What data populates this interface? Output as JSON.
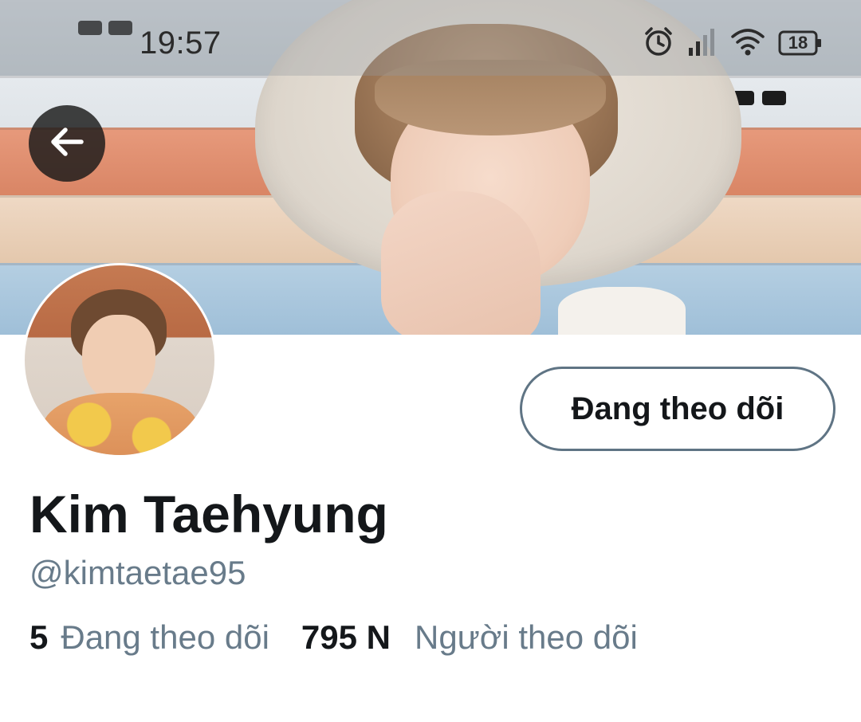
{
  "status_bar": {
    "time": "19:57",
    "battery": "18",
    "icons": [
      "alarm-icon",
      "signal-icon",
      "wifi-icon",
      "battery-icon"
    ]
  },
  "profile": {
    "follow_button_label": "Đang theo dõi",
    "name": "Kim Taehyung",
    "handle": "@kimtaetae95",
    "following_count": "5",
    "following_label": "Đang theo dõi",
    "followers_count": "795 N",
    "followers_label": "Người theo dõi"
  },
  "colors": {
    "text_primary": "#14171a",
    "text_secondary": "#687b8a",
    "button_border": "#5f7484",
    "back_button_bg": "#191919"
  }
}
